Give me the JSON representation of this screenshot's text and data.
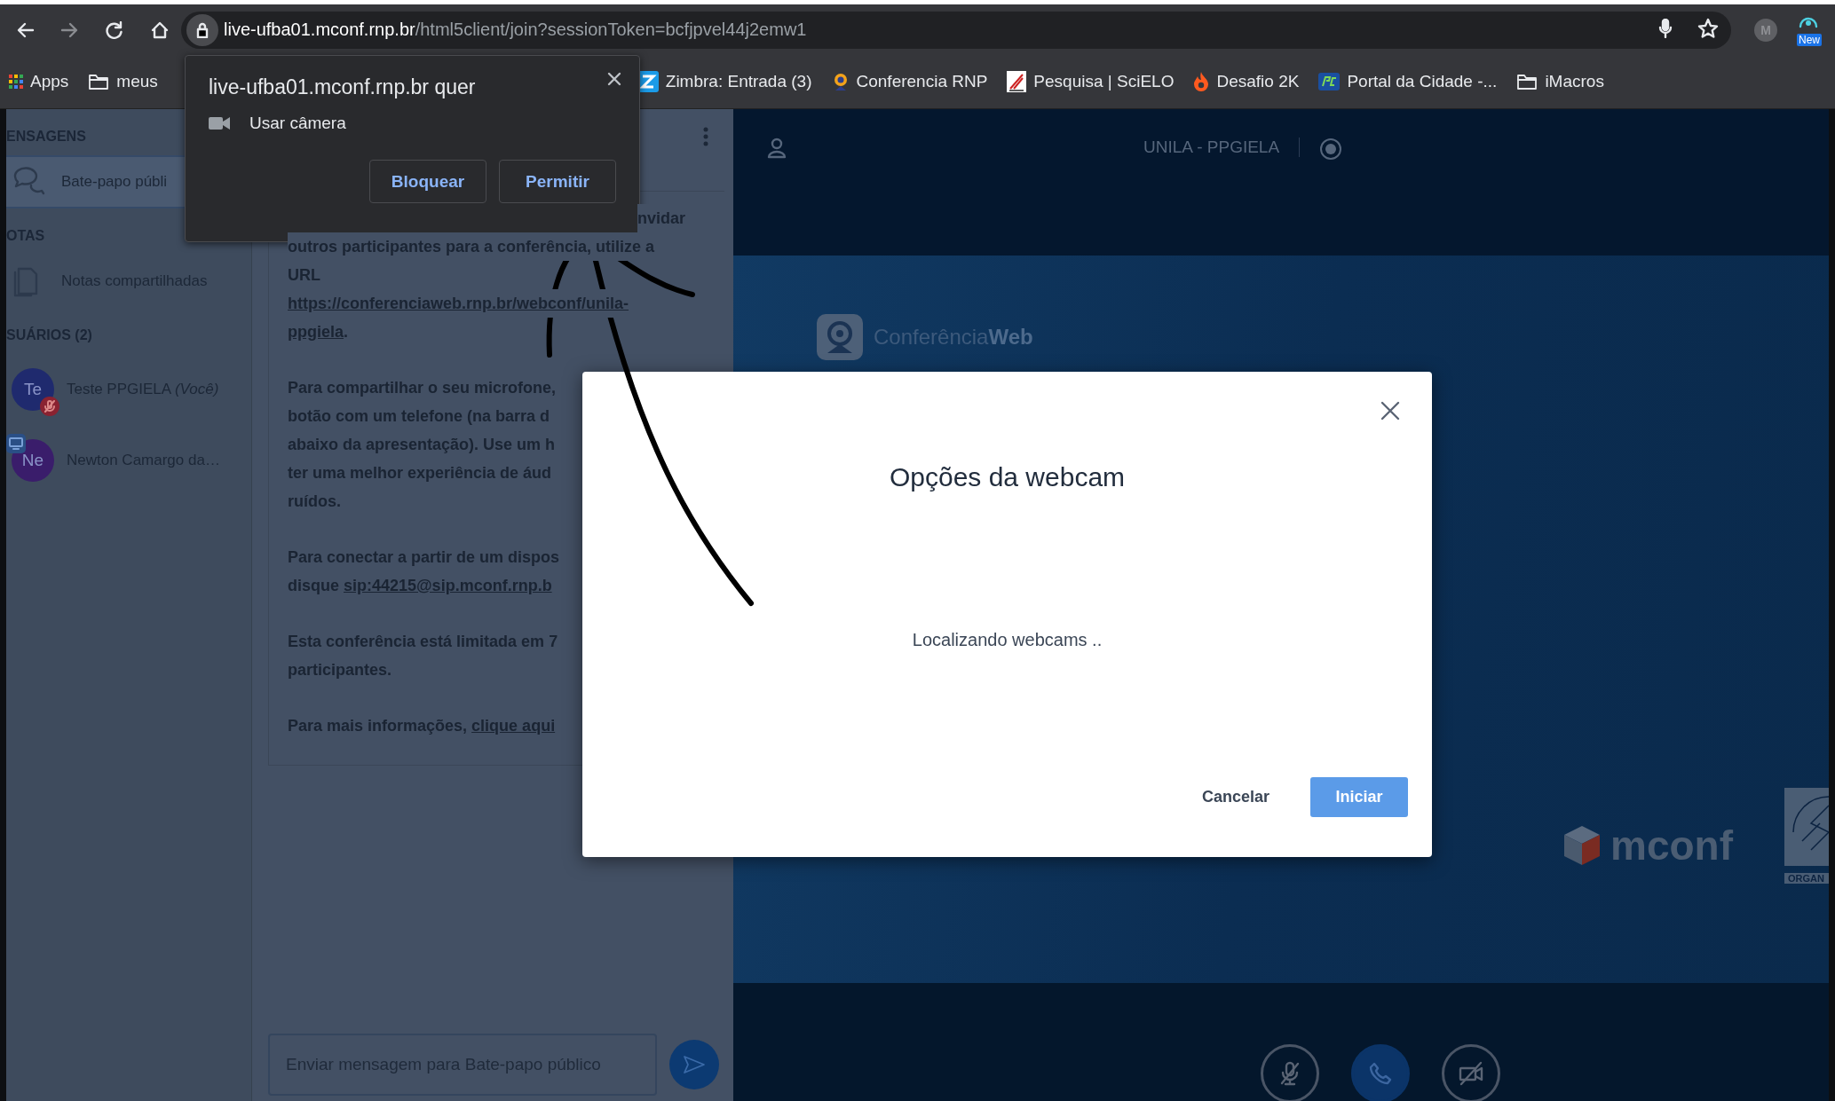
{
  "browser": {
    "nav_buttons": [
      {
        "kind": "back",
        "disabled": false
      },
      {
        "kind": "forward",
        "disabled": true
      },
      {
        "kind": "reload",
        "disabled": false
      },
      {
        "kind": "home",
        "disabled": false
      }
    ],
    "address_bar": {
      "host": "live-ufba01.mconf.rnp.br",
      "path": "/html5client/join?sessionToken=bcfjpvel44j2emw1"
    },
    "profile_initial": "M",
    "extension_badge": "New",
    "bookmarks": [
      {
        "kind": "apps",
        "label": "Apps"
      },
      {
        "kind": "folder",
        "label": "meus"
      },
      {
        "kind": "zimbra",
        "label": "Zimbra: Entrada (3)"
      },
      {
        "kind": "conferencia",
        "label": "Conferencia RNP"
      },
      {
        "kind": "scielo",
        "label": "Pesquisa | SciELO"
      },
      {
        "kind": "flame",
        "label": "Desafio 2K"
      },
      {
        "kind": "portal",
        "label": "Portal da Cidade -..."
      },
      {
        "kind": "folder",
        "label": "iMacros"
      }
    ]
  },
  "permission_prompt": {
    "title": "live-ufba01.mconf.rnp.br quer",
    "permission": "Usar câmera",
    "buttons": [
      "Bloquear",
      "Permitir"
    ]
  },
  "sidebar": {
    "sections": [
      {
        "heading": "ENSAGENS",
        "items": [
          {
            "kind": "chat",
            "label": "Bate-papo públi",
            "selected": true
          }
        ]
      },
      {
        "heading": "OTAS",
        "items": [
          {
            "kind": "notes",
            "label": "Notas compartilhadas",
            "selected": false
          }
        ]
      }
    ],
    "users_heading": "SUÁRIOS (2)",
    "users": [
      {
        "initials": "Te",
        "name": "Teste PPGIELA *(Você)*",
        "color": "#1f2a6e",
        "muted": true,
        "presenter": false
      },
      {
        "initials": "Ne",
        "name": "Newton Camargo da…",
        "color": "#3a1d6b",
        "muted": false,
        "presenter": true
      }
    ]
  },
  "chat": {
    "paragraphs": [
      [
        {
          "kind": "tail",
          "segments": [
            {
              "text": "nvidar",
              "link": false
            }
          ]
        },
        {
          "kind": "full",
          "segments": [
            {
              "text": "outros participantes para a conferência, utilize a",
              "link": false
            }
          ]
        },
        {
          "kind": "full",
          "segments": [
            {
              "text": "URL",
              "link": false
            }
          ]
        },
        {
          "kind": "full",
          "segments": [
            {
              "text": "https://conferenciaweb.rnp.br/webconf/unila-",
              "link": true
            }
          ]
        },
        {
          "kind": "full",
          "segments": [
            {
              "text": "ppgiela",
              "link": true
            },
            {
              "text": ".",
              "link": false
            }
          ]
        }
      ],
      [
        {
          "kind": "full",
          "segments": [
            {
              "text": "Para compartilhar o seu microfone,",
              "link": false
            }
          ]
        },
        {
          "kind": "full",
          "segments": [
            {
              "text": "botão com um telefone (na barra d",
              "link": false
            }
          ]
        },
        {
          "kind": "full",
          "segments": [
            {
              "text": "abaixo da apresentação). Use um h",
              "link": false
            }
          ]
        },
        {
          "kind": "full",
          "segments": [
            {
              "text": "ter uma melhor experiência de áud",
              "link": false
            }
          ]
        },
        {
          "kind": "full",
          "segments": [
            {
              "text": "ruídos.",
              "link": false
            }
          ]
        }
      ],
      [
        {
          "kind": "full",
          "segments": [
            {
              "text": "Para conectar a partir de um dispos",
              "link": false
            }
          ]
        },
        {
          "kind": "full",
          "segments": [
            {
              "text": "disque ",
              "link": false
            },
            {
              "text": "sip:44215@sip.mconf.rnp.b",
              "link": true
            }
          ]
        }
      ],
      [
        {
          "kind": "full",
          "segments": [
            {
              "text": "Esta conferência está limitada em 7",
              "link": false
            }
          ]
        },
        {
          "kind": "full",
          "segments": [
            {
              "text": "**participantes**.",
              "link": false
            }
          ]
        }
      ],
      [
        {
          "kind": "full",
          "segments": [
            {
              "text": "Para mais informações, ",
              "link": false
            },
            {
              "text": "clique aqui",
              "link": true
            }
          ]
        }
      ]
    ],
    "input": {
      "placeholder": "Enviar mensagem para Bate-papo público"
    }
  },
  "main": {
    "title": "UNILA - PPGIELA",
    "logos": {
      "conference": "Conferência**Web**",
      "mconf": "mconf",
      "partial": "ORGAN"
    },
    "controls": [
      {
        "kind": "mic",
        "on": false
      },
      {
        "kind": "phone",
        "on": true
      },
      {
        "kind": "camera",
        "on": false
      }
    ]
  },
  "modal": {
    "title": "Opções da webcam",
    "message": "Localizando webcams ..",
    "buttons": [
      {
        "kind": "secondary",
        "label": "Cancelar"
      },
      {
        "kind": "primary",
        "label": "Iniciar"
      }
    ]
  }
}
